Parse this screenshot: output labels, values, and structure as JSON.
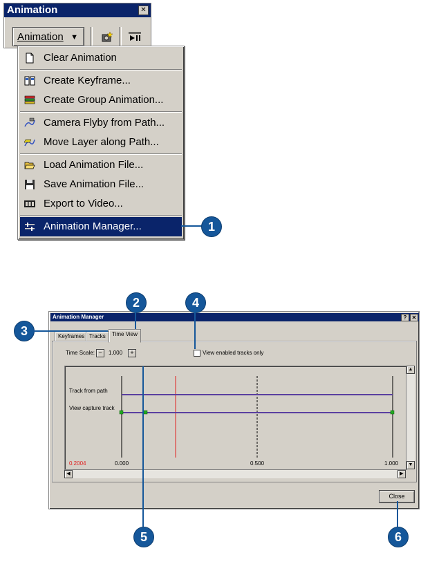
{
  "toolbar": {
    "title": "Animation",
    "close_glyph": "✕",
    "dropdown_label": "Animation",
    "dropdown_arrow": "▼",
    "buttons": [
      {
        "icon": "camera-capture-icon",
        "glyph": "📷"
      },
      {
        "icon": "play-pause-icon",
        "glyph": "▶‖"
      }
    ]
  },
  "menu": {
    "items": [
      {
        "label": "Clear Animation",
        "icon": "clear-document-icon",
        "glyph": "▭"
      },
      {
        "label": "Create Keyframe...",
        "icon": "keyframe-icon",
        "glyph": "▤"
      },
      {
        "label": "Create Group Animation...",
        "icon": "group-layers-icon",
        "glyph": "≣"
      },
      {
        "label": "Camera Flyby from Path...",
        "icon": "camera-path-icon",
        "glyph": "≈"
      },
      {
        "label": "Move Layer along Path...",
        "icon": "layer-path-icon",
        "glyph": "≋"
      },
      {
        "label": "Load Animation File...",
        "icon": "open-folder-icon",
        "glyph": "▰"
      },
      {
        "label": "Save Animation File...",
        "icon": "floppy-disk-icon",
        "glyph": "▣"
      },
      {
        "label": "Export to Video...",
        "icon": "film-strip-icon",
        "glyph": "▥"
      },
      {
        "label": "Animation Manager...",
        "icon": "sliders-icon",
        "glyph": "⊹",
        "selected": true
      }
    ]
  },
  "callouts": [
    "1",
    "2",
    "3",
    "4",
    "5",
    "6"
  ],
  "dialog": {
    "title": "Animation Manager",
    "help_glyph": "?",
    "close_glyph": "✕",
    "tabs": [
      "Keyframes",
      "Tracks",
      "Time View"
    ],
    "time_scale_label": "Time Scale:",
    "minus": "−",
    "plus": "+",
    "time_scale_value": "1.000",
    "view_enabled_label": "View enabled tracks only",
    "tracks": [
      "Track from path",
      "View capture track"
    ],
    "current_time": "0.2004",
    "axis_ticks": [
      "0.000",
      "0.500",
      "1.000"
    ],
    "close_button": "Close",
    "colors": {
      "track_line": "#5a3fa0",
      "current_time_line": "#e02020",
      "keyframe": "#22aa22",
      "title_bar": "#0a246a"
    }
  }
}
